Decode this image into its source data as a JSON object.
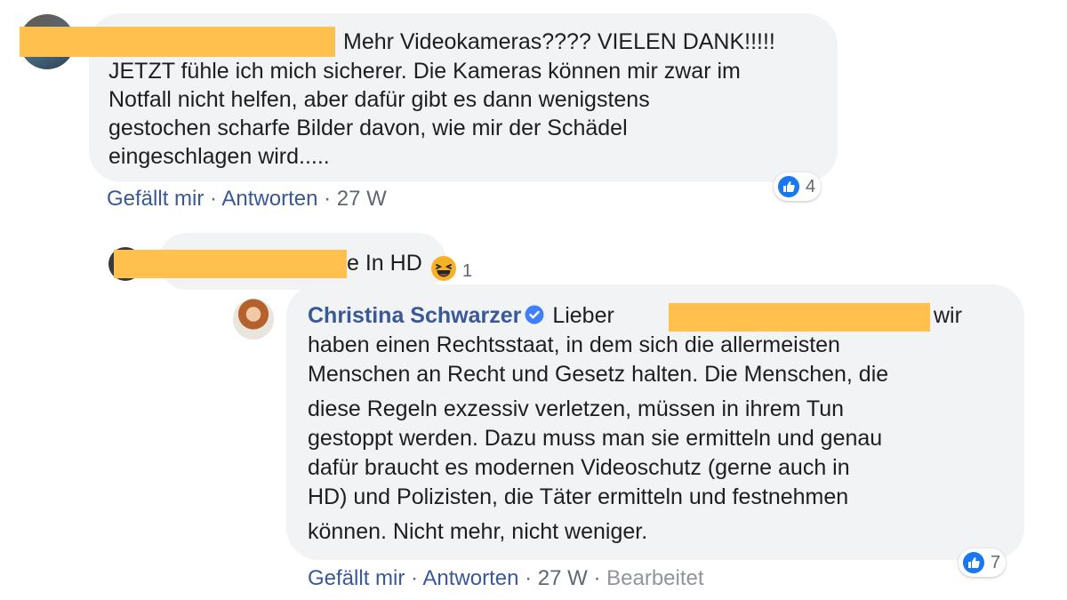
{
  "comments": [
    {
      "lines": [
        "Mehr Videokameras???? VIELEN DANK!!!!!",
        "JETZT fühle ich mich sicherer. Die Kameras können mir zwar im",
        "Notfall nicht helfen, aber dafür gibt es dann wenigstens",
        "gestochen scharfe Bilder davon, wie mir der Schädel",
        "eingeschlagen wird....."
      ],
      "actions": {
        "like": "Gefällt mir",
        "reply": "Antworten",
        "time": "27 W"
      },
      "reaction_count": "4"
    },
    {
      "text": "e In HD",
      "reaction_count": "1"
    },
    {
      "author": "Christina Schwarzer",
      "lines": [
        "Lieber",
        "wir",
        "haben einen Rechtsstaat, in dem sich die allermeisten",
        "Menschen an Recht und Gesetz halten. Die Menschen, die",
        "diese Regeln exzessiv verletzen, müssen in ihrem Tun",
        "gestoppt werden. Dazu muss man sie ermitteln und genau",
        "dafür braucht es modernen Videoschutz (gerne auch in",
        "HD) und Polizisten, die Täter ermitteln und festnehmen",
        "können. Nicht mehr, nicht weniger."
      ],
      "actions": {
        "like": "Gefällt mir",
        "reply": "Antworten",
        "time": "27 W",
        "edited": "Bearbeitet"
      },
      "reaction_count": "7"
    }
  ],
  "separator": "·",
  "colors": {
    "link": "#385898",
    "redaction": "#ffc04d",
    "bubble": "#f2f3f5",
    "like": "#1877f2"
  },
  "icons": [
    "like-icon",
    "haha-icon",
    "verified-badge-icon"
  ]
}
